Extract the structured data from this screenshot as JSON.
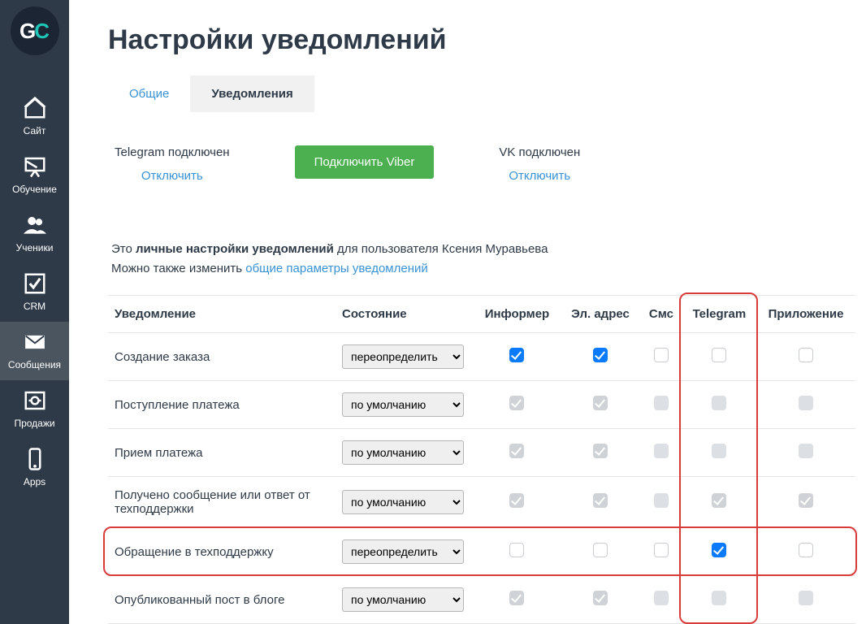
{
  "logo": {
    "g": "G",
    "c": "C"
  },
  "sidebar": {
    "items": [
      {
        "label": "Сайт",
        "icon": "home"
      },
      {
        "label": "Обучение",
        "icon": "board"
      },
      {
        "label": "Ученики",
        "icon": "users"
      },
      {
        "label": "CRM",
        "icon": "checkbox"
      },
      {
        "label": "Сообщения",
        "icon": "mail",
        "active": true
      },
      {
        "label": "Продажи",
        "icon": "safe"
      },
      {
        "label": "Apps",
        "icon": "phone"
      }
    ]
  },
  "page": {
    "title": "Настройки уведомлений",
    "tabs": [
      {
        "label": "Общие",
        "active": false
      },
      {
        "label": "Уведомления",
        "active": true
      }
    ]
  },
  "connect": {
    "telegram_label": "Telegram подключен",
    "telegram_action": "Отключить",
    "viber_button": "Подключить Viber",
    "vk_label": "VK подключен",
    "vk_action": "Отключить"
  },
  "desc": {
    "prefix": "Это ",
    "bold": "личные настройки уведомлений",
    "suffix": " для пользователя Ксения Муравьева",
    "line2_prefix": "Можно также изменить ",
    "line2_link": "общие параметры уведомлений"
  },
  "table": {
    "headers": [
      "Уведомление",
      "Состояние",
      "Информер",
      "Эл. адрес",
      "Смс",
      "Telegram",
      "Приложение"
    ],
    "state_options": [
      "переопределить",
      "по умолчанию"
    ],
    "rows": [
      {
        "name": "Создание заказа",
        "state": "переопределить",
        "cells": [
          {
            "checked": true,
            "disabled": false
          },
          {
            "checked": true,
            "disabled": false
          },
          {
            "checked": false,
            "disabled": false
          },
          {
            "checked": false,
            "disabled": false
          },
          {
            "checked": false,
            "disabled": false
          }
        ]
      },
      {
        "name": "Поступление платежа",
        "state": "по умолчанию",
        "cells": [
          {
            "checked": true,
            "disabled": true
          },
          {
            "checked": true,
            "disabled": true
          },
          {
            "checked": false,
            "disabled": true
          },
          {
            "checked": false,
            "disabled": true
          },
          {
            "checked": false,
            "disabled": true
          }
        ]
      },
      {
        "name": "Прием платежа",
        "state": "по умолчанию",
        "cells": [
          {
            "checked": true,
            "disabled": true
          },
          {
            "checked": true,
            "disabled": true
          },
          {
            "checked": false,
            "disabled": true
          },
          {
            "checked": false,
            "disabled": true
          },
          {
            "checked": false,
            "disabled": true
          }
        ]
      },
      {
        "name": "Получено сообщение или ответ от техподдержки",
        "state": "по умолчанию",
        "cells": [
          {
            "checked": true,
            "disabled": true
          },
          {
            "checked": true,
            "disabled": true
          },
          {
            "checked": false,
            "disabled": true
          },
          {
            "checked": true,
            "disabled": true
          },
          {
            "checked": true,
            "disabled": true
          }
        ]
      },
      {
        "name": "Обращение в техподдержку",
        "state": "переопределить",
        "cells": [
          {
            "checked": false,
            "disabled": false
          },
          {
            "checked": false,
            "disabled": false
          },
          {
            "checked": false,
            "disabled": false
          },
          {
            "checked": true,
            "disabled": false
          },
          {
            "checked": false,
            "disabled": false
          }
        ]
      },
      {
        "name": "Опубликованный пост в блоге",
        "state": "по умолчанию",
        "cells": [
          {
            "checked": true,
            "disabled": true
          },
          {
            "checked": true,
            "disabled": true
          },
          {
            "checked": false,
            "disabled": true
          },
          {
            "checked": false,
            "disabled": true
          },
          {
            "checked": false,
            "disabled": true
          }
        ]
      }
    ],
    "highlight_column_index": 5,
    "highlight_row_index": 4
  }
}
